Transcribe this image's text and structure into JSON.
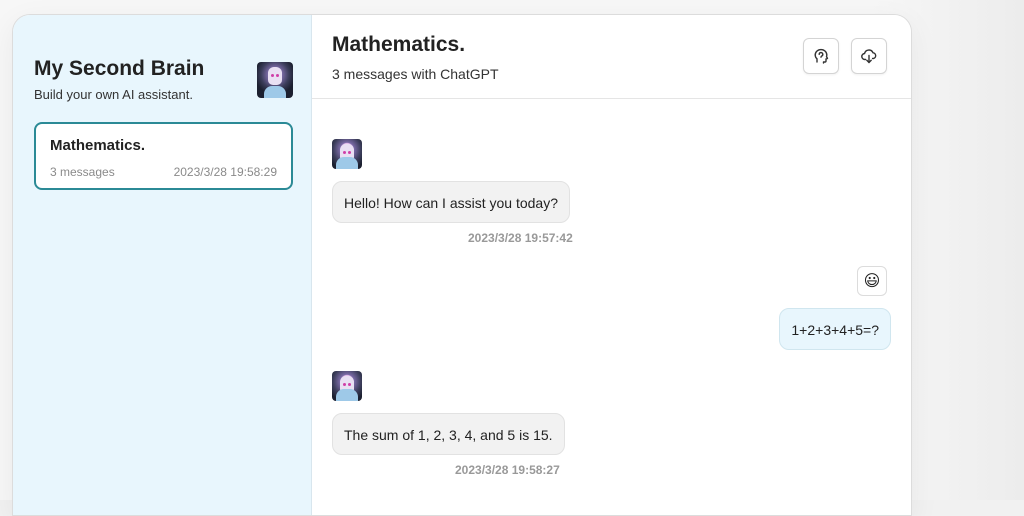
{
  "sidebar": {
    "title": "My Second Brain",
    "subtitle": "Build your own AI assistant.",
    "conversations": [
      {
        "title": "Mathematics.",
        "count": "3 messages",
        "time": "2023/3/28 19:58:29"
      }
    ]
  },
  "header": {
    "title": "Mathematics.",
    "subtitle": "3 messages with ChatGPT"
  },
  "messages": [
    {
      "role": "assistant",
      "text": "Hello! How can I assist you today?",
      "time": "2023/3/28 19:57:42"
    },
    {
      "role": "user",
      "text": "1+2+3+4+5=?",
      "avatar": "😃"
    },
    {
      "role": "assistant",
      "text": "The sum of 1, 2, 3, 4, and 5 is 15.",
      "time": "2023/3/28 19:58:27"
    }
  ],
  "icons": {
    "persona": "face-icon",
    "download": "cloud-download-icon"
  },
  "colors": {
    "accent": "#2b8a96",
    "sidebar_bg": "#e8f6fd",
    "bot_bubble": "#f2f2f2",
    "user_bubble": "#e8f6fd"
  }
}
